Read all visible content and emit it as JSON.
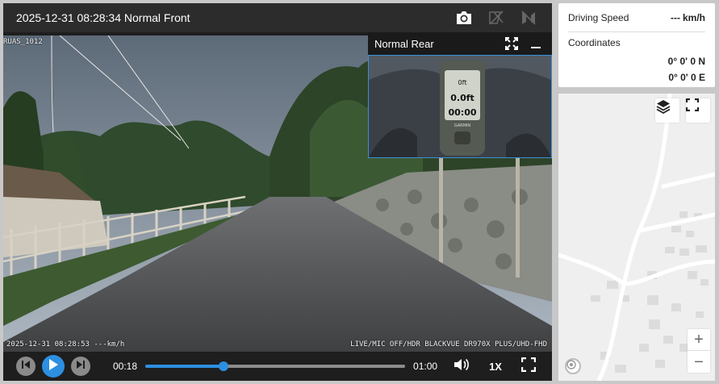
{
  "player": {
    "title": "2025-12-31 08:28:34 Normal Front",
    "icons": {
      "snapshot": "camera-icon",
      "flip": "flip-icon",
      "mute-channel": "camera-off-icon"
    }
  },
  "front_video": {
    "cam_tag": "RUAS_1012",
    "osd_left": "2025-12-31 08:28:53 ---km/h",
    "osd_right": "LIVE/MIC OFF/HDR BLACKVUE DR970X PLUS/UHD-FHD"
  },
  "rear_pip": {
    "title": "Normal Rear",
    "icons": {
      "expand": "expand-icon",
      "minimize": "minimize-icon"
    },
    "gps_screen": {
      "line1": "0ft",
      "line2": "0.0ft",
      "line3": "00:00",
      "brand": "GARMIN"
    }
  },
  "controls": {
    "time_current": "00:18",
    "time_total": "01:00",
    "progress": 0.3,
    "speed": "1X",
    "icons": {
      "prev": "skip-back-icon",
      "play": "play-icon",
      "next": "skip-forward-icon",
      "volume": "volume-icon",
      "fullscreen": "fullscreen-icon"
    }
  },
  "info": {
    "speed_label": "Driving Speed",
    "speed_value": "---",
    "speed_unit": "km/h",
    "coordinates_label": "Coordinates",
    "lat": "0° 0'   0 N",
    "lon": "0° 0'   0 E"
  },
  "map": {
    "icons": {
      "layers": "layers-icon",
      "fullscreen": "fullscreen-icon",
      "attribution": "info-icon"
    },
    "zoom_in": "+",
    "zoom_out": "−"
  },
  "colors": {
    "accent": "#2d8fe0",
    "panel_dark": "#2c2c2c",
    "map_bg": "#efefef"
  }
}
